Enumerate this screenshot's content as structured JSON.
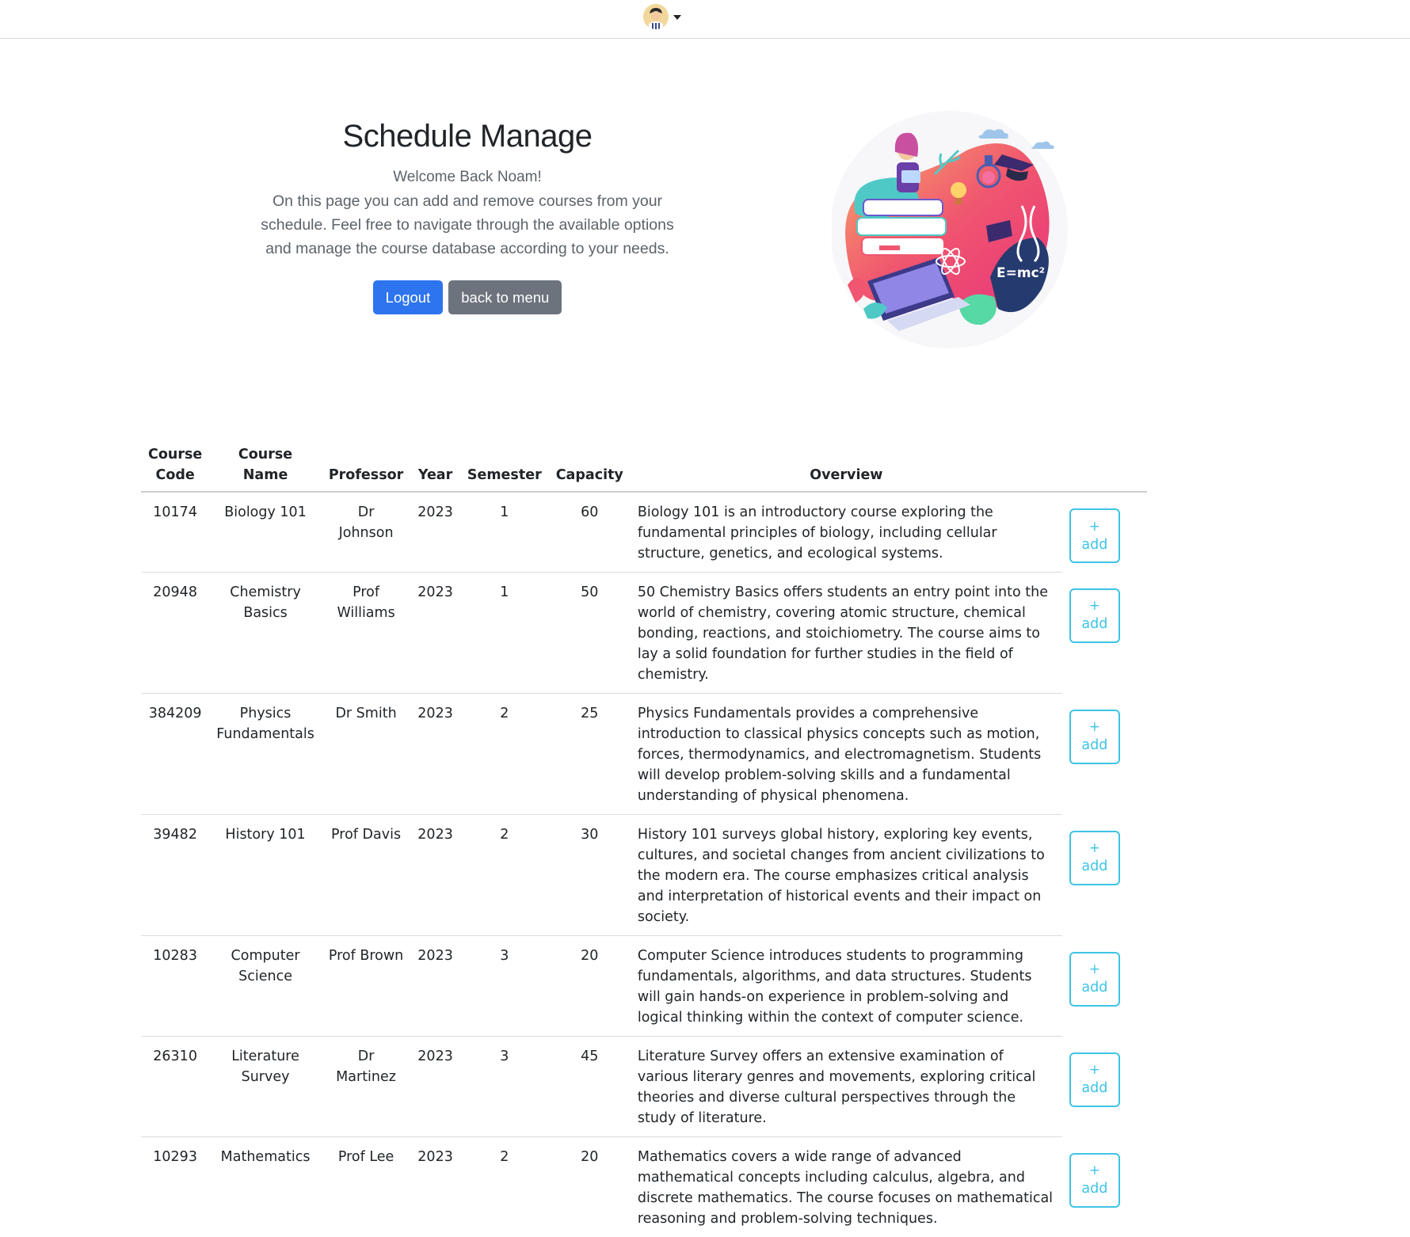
{
  "header": {
    "avatar_icon": "user-avatar-icon",
    "menu_icon": "caret-down-icon"
  },
  "hero": {
    "title": "Schedule Manage",
    "welcome": "Welcome Back Noam!",
    "description": "On this page you can add and remove courses from your schedule. Feel free to navigate through the available options and manage the course database according to your needs.",
    "logout_label": "Logout",
    "back_label": "back to menu",
    "illustration_text": "E=mc²"
  },
  "table": {
    "headers": {
      "code": "Course Code",
      "name": "Course Name",
      "professor": "Professor",
      "year": "Year",
      "semester": "Semester",
      "capacity": "Capacity",
      "overview": "Overview"
    },
    "add_plus": "+",
    "add_label": "add",
    "rows": [
      {
        "code": "10174",
        "name": "Biology 101",
        "professor": "Dr Johnson",
        "year": "2023",
        "semester": "1",
        "capacity": "60",
        "overview": "Biology 101 is an introductory course exploring the fundamental principles of biology, including cellular structure, genetics, and ecological systems."
      },
      {
        "code": "20948",
        "name": "Chemistry Basics",
        "professor": "Prof Williams",
        "year": "2023",
        "semester": "1",
        "capacity": "50",
        "overview": "50 Chemistry Basics offers students an entry point into the world of chemistry, covering atomic structure, chemical bonding, reactions, and stoichiometry. The course aims to lay a solid foundation for further studies in the field of chemistry."
      },
      {
        "code": "384209",
        "name": "Physics Fundamentals",
        "professor": "Dr Smith",
        "year": "2023",
        "semester": "2",
        "capacity": "25",
        "overview": "Physics Fundamentals provides a comprehensive introduction to classical physics concepts such as motion, forces, thermodynamics, and electromagnetism. Students will develop problem-solving skills and a fundamental understanding of physical phenomena."
      },
      {
        "code": "39482",
        "name": "History 101",
        "professor": "Prof Davis",
        "year": "2023",
        "semester": "2",
        "capacity": "30",
        "overview": "History 101 surveys global history, exploring key events, cultures, and societal changes from ancient civilizations to the modern era. The course emphasizes critical analysis and interpretation of historical events and their impact on society."
      },
      {
        "code": "10283",
        "name": "Computer Science",
        "professor": "Prof Brown",
        "year": "2023",
        "semester": "3",
        "capacity": "20",
        "overview": "Computer Science introduces students to programming fundamentals, algorithms, and data structures. Students will gain hands-on experience in problem-solving and logical thinking within the context of computer science."
      },
      {
        "code": "26310",
        "name": "Literature Survey",
        "professor": "Dr Martinez",
        "year": "2023",
        "semester": "3",
        "capacity": "45",
        "overview": "Literature Survey offers an extensive examination of various literary genres and movements, exploring critical theories and diverse cultural perspectives through the study of literature."
      },
      {
        "code": "10293",
        "name": "Mathematics",
        "professor": "Prof Lee",
        "year": "2023",
        "semester": "2",
        "capacity": "20",
        "overview": "Mathematics covers a wide range of advanced mathematical concepts including calculus, algebra, and discrete mathematics. The course focuses on mathematical reasoning and problem-solving techniques."
      }
    ]
  },
  "colors": {
    "primary": "#2d74ee",
    "secondary": "#6c737c",
    "add_outline": "#3ec4e6"
  }
}
